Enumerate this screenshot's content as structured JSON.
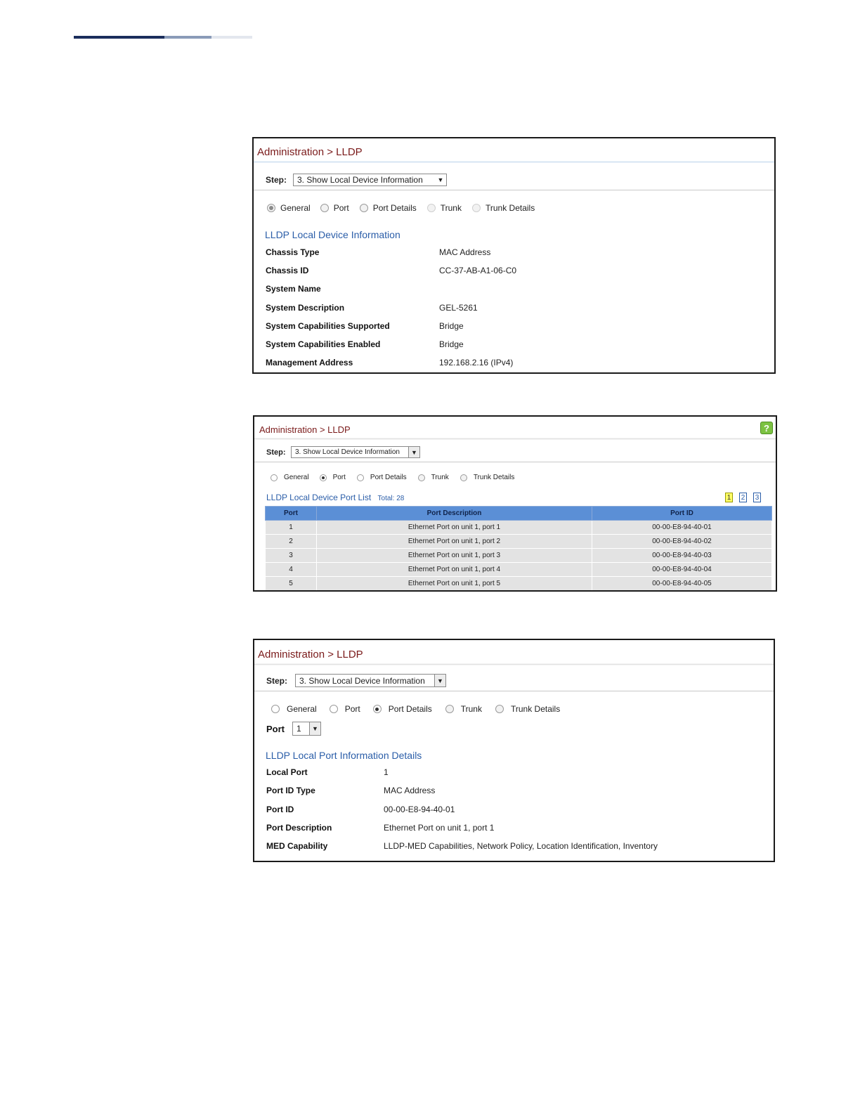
{
  "panel1": {
    "title": "Administration > LLDP",
    "step_label": "Step:",
    "step_value": "3. Show Local Device Information",
    "radios": [
      {
        "label": "General",
        "selected": true
      },
      {
        "label": "Port",
        "selected": false
      },
      {
        "label": "Port Details",
        "selected": false
      },
      {
        "label": "Trunk",
        "selected": false
      },
      {
        "label": "Trunk Details",
        "selected": false
      }
    ],
    "section_title": "LLDP Local Device Information",
    "rows": [
      {
        "label": "Chassis Type",
        "value": "MAC Address"
      },
      {
        "label": "Chassis ID",
        "value": "CC-37-AB-A1-06-C0"
      },
      {
        "label": "System Name",
        "value": ""
      },
      {
        "label": "System Description",
        "value": "GEL-5261"
      },
      {
        "label": "System Capabilities Supported",
        "value": "Bridge"
      },
      {
        "label": "System Capabilities Enabled",
        "value": "Bridge"
      },
      {
        "label": "Management Address",
        "value": "192.168.2.16 (IPv4)"
      }
    ]
  },
  "panel2": {
    "title": "Administration > LLDP",
    "help_icon": "?",
    "step_label": "Step:",
    "step_value": "3. Show Local Device Information",
    "radios": [
      {
        "label": "General",
        "selected": false
      },
      {
        "label": "Port",
        "selected": true
      },
      {
        "label": "Port Details",
        "selected": false
      },
      {
        "label": "Trunk",
        "selected": false
      },
      {
        "label": "Trunk Details",
        "selected": false
      }
    ],
    "list_title": "LLDP Local Device Port List",
    "total": "Total: 28",
    "pages": [
      "1",
      "2",
      "3"
    ],
    "columns": [
      "Port",
      "Port Description",
      "Port ID"
    ],
    "rows": [
      [
        "1",
        "Ethernet Port on unit 1, port 1",
        "00-00-E8-94-40-01"
      ],
      [
        "2",
        "Ethernet Port on unit 1, port 2",
        "00-00-E8-94-40-02"
      ],
      [
        "3",
        "Ethernet Port on unit 1, port 3",
        "00-00-E8-94-40-03"
      ],
      [
        "4",
        "Ethernet Port on unit 1, port 4",
        "00-00-E8-94-40-04"
      ],
      [
        "5",
        "Ethernet Port on unit 1, port 5",
        "00-00-E8-94-40-05"
      ]
    ]
  },
  "panel3": {
    "title": "Administration > LLDP",
    "step_label": "Step:",
    "step_value": "3. Show Local Device Information",
    "radios": [
      {
        "label": "General",
        "selected": false
      },
      {
        "label": "Port",
        "selected": false
      },
      {
        "label": "Port Details",
        "selected": true
      },
      {
        "label": "Trunk",
        "selected": false
      },
      {
        "label": "Trunk Details",
        "selected": false
      }
    ],
    "port_label": "Port",
    "port_value": "1",
    "section_title": "LLDP Local Port Information Details",
    "rows": [
      {
        "label": "Local Port",
        "value": "1"
      },
      {
        "label": "Port ID Type",
        "value": "MAC Address"
      },
      {
        "label": "Port ID",
        "value": "00-00-E8-94-40-01"
      },
      {
        "label": "Port Description",
        "value": "Ethernet Port on unit 1, port 1"
      },
      {
        "label": "MED Capability",
        "value": "LLDP-MED Capabilities, Network Policy, Location Identification, Inventory"
      }
    ]
  }
}
